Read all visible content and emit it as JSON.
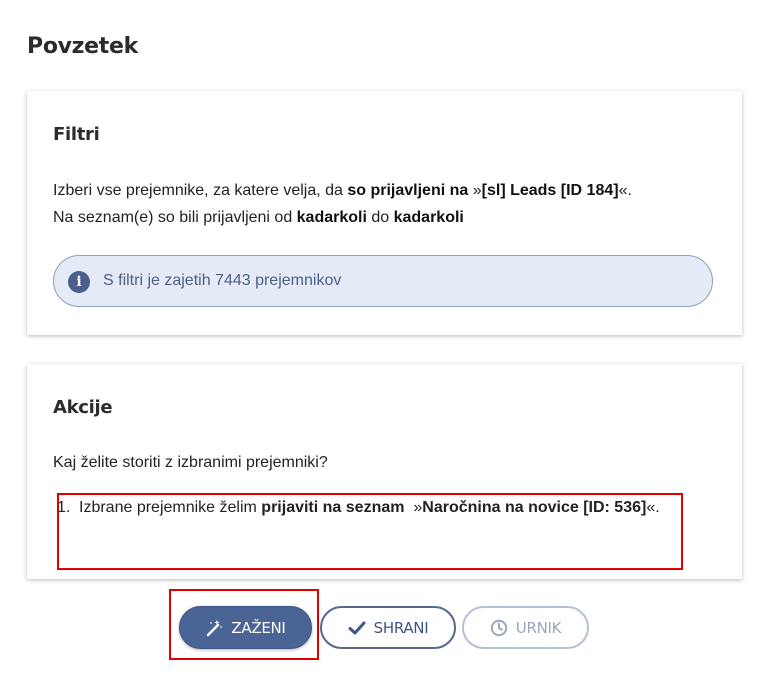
{
  "page": {
    "title": "Povzetek"
  },
  "filters": {
    "heading": "Filtri",
    "line1": {
      "t1": "Izberi vse prejemnike, za katere velja, da ",
      "b1": "so prijavljeni na",
      "t2": " »",
      "b2": "[sl] Leads [ID 184]",
      "t3": "«."
    },
    "line2": {
      "t1": "Na seznam(e) so bili prijavljeni od ",
      "b1": "kadarkoli",
      "t2": " do ",
      "b2": "kadarkoli"
    },
    "info": {
      "icon": "info-icon",
      "text": "S filtri je zajetih 7443 prejemnikov"
    }
  },
  "actions": {
    "heading": "Akcije",
    "question": "Kaj želite storiti z izbranimi prejemniki?",
    "items": [
      {
        "number": "1.",
        "t1": "Izbrane prejemnike želim ",
        "b1": "prijaviti na seznam",
        "t2": "  »",
        "b2": "Naročnina na novice [ID: 536]",
        "t3": "«."
      }
    ]
  },
  "buttons": {
    "run": {
      "label": "ZAŽENI",
      "icon": "magic-wand-icon"
    },
    "save": {
      "label": "SHRANI",
      "icon": "check-icon"
    },
    "schedule": {
      "label": "URNIK",
      "icon": "clock-icon"
    }
  },
  "colors": {
    "primary": "#4a6495",
    "info_bg": "#e4ebf7",
    "info_text": "#4d5f88",
    "highlight": "#e00000"
  }
}
